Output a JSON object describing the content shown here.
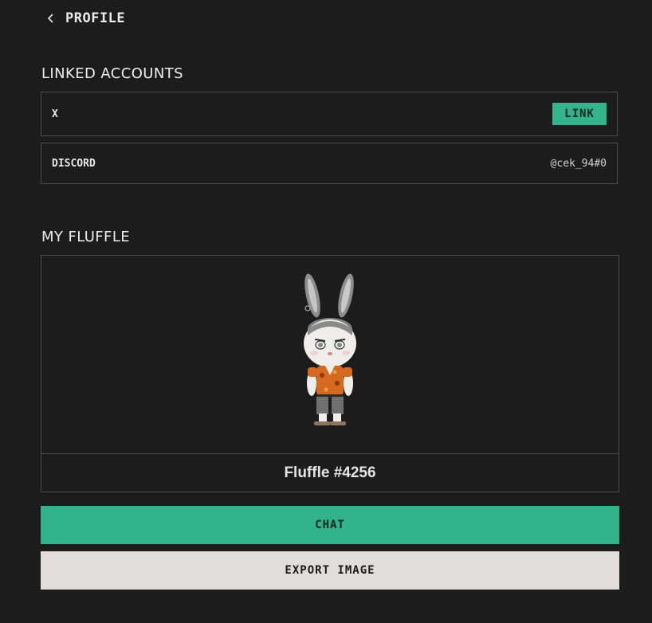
{
  "header": {
    "back_icon": "chevron-left-icon",
    "title": "PROFILE"
  },
  "linked_accounts": {
    "title": "LINKED ACCOUNTS",
    "accounts": [
      {
        "name": "X",
        "action_label": "LINK"
      },
      {
        "name": "DISCORD",
        "handle": "@cek_94#0"
      }
    ]
  },
  "my_fluffle": {
    "title": "MY FLUFFLE",
    "avatar_icon": "bunny-character-image",
    "name": "Fluffle #4256"
  },
  "actions": {
    "chat_label": "CHAT",
    "export_label": "EXPORT IMAGE"
  },
  "colors": {
    "background": "#1c1c1c",
    "accent": "#31b389",
    "export_button_bg": "#e2dddd",
    "border": "#4a4a4a"
  }
}
